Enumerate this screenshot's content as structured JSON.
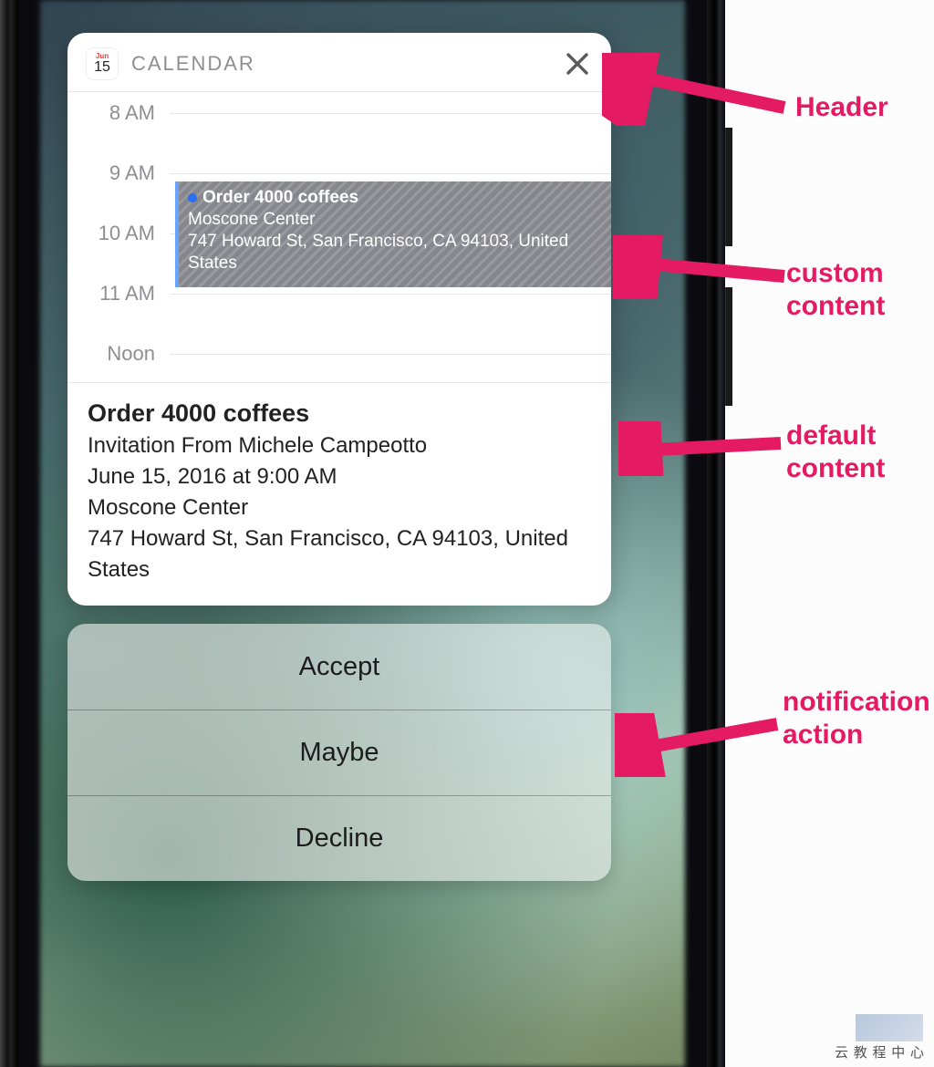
{
  "header": {
    "app_name": "CALENDAR",
    "icon_month": "Jun",
    "icon_day": "15"
  },
  "timeline": {
    "hours": [
      "8 AM",
      "9 AM",
      "10 AM",
      "11 AM",
      "Noon"
    ],
    "event": {
      "title": "Order 4000 coffees",
      "location": "Moscone Center",
      "address": "747 Howard St, San Francisco, CA  94103, United States"
    }
  },
  "default_content": {
    "title": "Order 4000 coffees",
    "invitation": "Invitation From Michele Campeotto",
    "datetime": "June 15, 2016 at 9:00 AM",
    "location": "Moscone Center",
    "address": "747 Howard St, San Francisco, CA  94103, United States"
  },
  "actions": {
    "accept": "Accept",
    "maybe": "Maybe",
    "decline": "Decline"
  },
  "callouts": {
    "header": "Header",
    "custom": "custom content",
    "default": "default content",
    "action": "notification action"
  },
  "watermark": "云 教 程 中 心",
  "colors": {
    "accent_pink": "#e41a63",
    "event_border": "#67a4ff"
  }
}
